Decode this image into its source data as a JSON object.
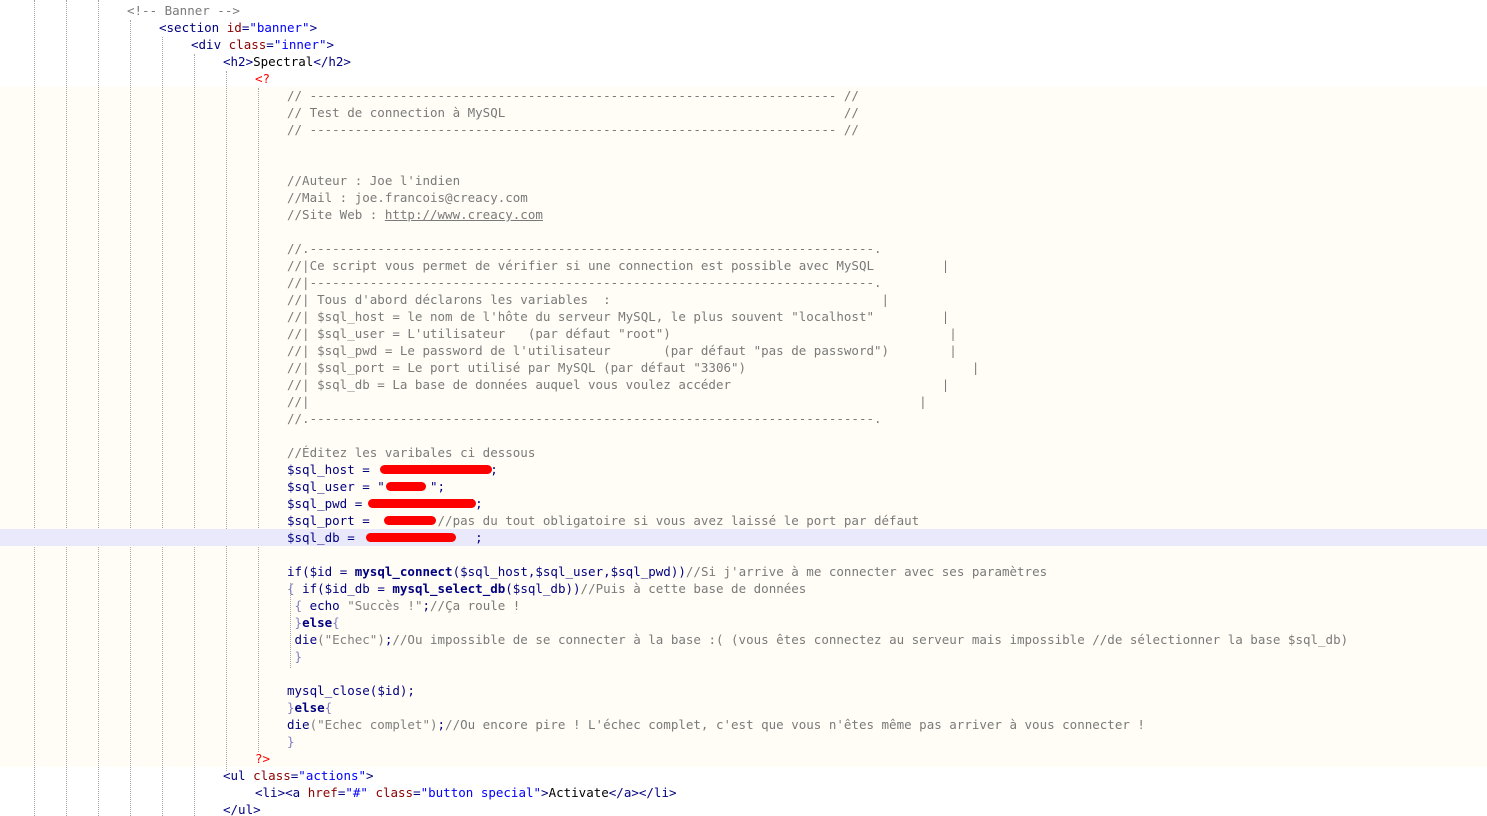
{
  "editor": {
    "colors": {
      "php_background": "#fffdf5",
      "current_line": "#e9e9fb",
      "php_delimiter": "#ff0000",
      "redaction": "#ff0000"
    },
    "lines": {
      "l0": {
        "comment": "<!-- Banner -->"
      },
      "l1": {
        "open": "<",
        "tag": "section",
        "attr": "id",
        "eq": "=",
        "val": "\"banner\"",
        "close": ">"
      },
      "l2": {
        "open": "<",
        "tag": "div",
        "attr": "class",
        "eq": "=",
        "val": "\"inner\"",
        "close": ">"
      },
      "l3": {
        "open": "<h2>",
        "text": "Spectral",
        "close": "</h2>"
      },
      "l4": {
        "php": "<?"
      },
      "l5": {
        "comment": "// ---------------------------------------------------------------------- //"
      },
      "l6": {
        "comment": "// Test de connection à MySQL                                             //"
      },
      "l7": {
        "comment": "// ---------------------------------------------------------------------- //"
      },
      "l10": {
        "comment": "//Auteur : Joe l'indien"
      },
      "l11": {
        "comment": "//Mail : joe.francois@creacy.com"
      },
      "l12": {
        "prefix": "//Site Web : ",
        "link": "http://www.creacy.com"
      },
      "l14": {
        "comment": "//.---------------------------------------------------------------------------."
      },
      "l15": {
        "comment": "//|Ce script vous permet de vérifier si une connection est possible avec MySQL         |"
      },
      "l16": {
        "comment": "//|---------------------------------------------------------------------------."
      },
      "l17": {
        "comment": "//| Tous d'abord déclarons les variables  :                                    |"
      },
      "l18": {
        "comment": "//| $sql_host = le nom de l'hôte du serveur MySQL, le plus souvent \"localhost\"         |"
      },
      "l19": {
        "comment": "//| $sql_user = L'utilisateur   (par défaut \"root\")                                     |"
      },
      "l20": {
        "comment": "//| $sql_pwd = Le password de l'utilisateur       (par défaut \"pas de password\")        |"
      },
      "l21": {
        "comment": "//| $sql_port = Le port utilisé par MySQL (par défaut \"3306\")                              |"
      },
      "l22": {
        "comment": "//| $sql_db = La base de données auquel vous voulez accéder                            |"
      },
      "l23": {
        "comment": "//|                                                                                 |"
      },
      "l24": {
        "comment": "//.---------------------------------------------------------------------------."
      },
      "l26": {
        "comment": "//Éditez les varibales ci dessous"
      },
      "l27": {
        "code": "$sql_host =                ;"
      },
      "l28": {
        "code": "$sql_user = \"      \";"
      },
      "l29": {
        "code": "$sql_pwd =              \";"
      },
      "l30": {
        "code": "$sql_port =         ",
        "comment": "//pas du tout obligatoire si vous avez laissé le port par défaut"
      },
      "l31": {
        "code": "$sql_db =                ;"
      },
      "l33": {
        "kw": "if",
        "p1": "(",
        "v1": "$id",
        "op": " = ",
        "fn": "mysql_connect",
        "args": "($sql_host,$sql_user,$sql_pwd))",
        "comment": "//Si j'arrive à me connecter avec ses paramètres"
      },
      "l34": {
        "brace": "{ ",
        "kw": "if",
        "p1": "(",
        "v1": "$id_db",
        "op": " = ",
        "fn": "mysql_select_db",
        "args": "($sql_db))",
        "comment": "//Puis à cette base de données"
      },
      "l35": {
        "brace": " { ",
        "kw": "echo",
        "str": " \"Succès !\"",
        "semi": ";",
        "comment": "//Ça roule !"
      },
      "l36": {
        "brace": " }",
        "kw": "else",
        "brace2": "{"
      },
      "l37": {
        "fn": " die",
        "str": "(\"Echec\")",
        "semi": ";",
        "comment": "//Ou impossible de se connecter à la base :( (vous êtes connectez au serveur mais impossible //de sélectionner la base $sql_db)"
      },
      "l38": {
        "brace": " }"
      },
      "l40": {
        "fn": "mysql_close",
        "args": "($id);"
      },
      "l41": {
        "brace": "}",
        "kw": "else",
        "brace2": "{"
      },
      "l42": {
        "fn": "die",
        "str": "(\"Echec complet\")",
        "semi": ";",
        "comment": "//Ou encore pire ! L'échec complet, c'est que vous n'êtes même pas arriver à vous connecter !"
      },
      "l43": {
        "brace": "}"
      },
      "l44": {
        "php": "?>"
      },
      "l45": {
        "open": "<",
        "tag": "ul",
        "attr": "class",
        "eq": "=",
        "val": "\"actions\"",
        "close": ">"
      },
      "l46": {
        "li_open": "<li>",
        "a_open": "<",
        "a_tag": "a",
        "href_attr": " href",
        "eq": "=",
        "href_val": "\"#\"",
        "class_attr": " class",
        "eq2": "=",
        "class_val": "\"button special\"",
        "a_close": ">",
        "text": "Activate",
        "end": "</a></li>"
      },
      "l47": {
        "close": "</ul>"
      }
    }
  }
}
